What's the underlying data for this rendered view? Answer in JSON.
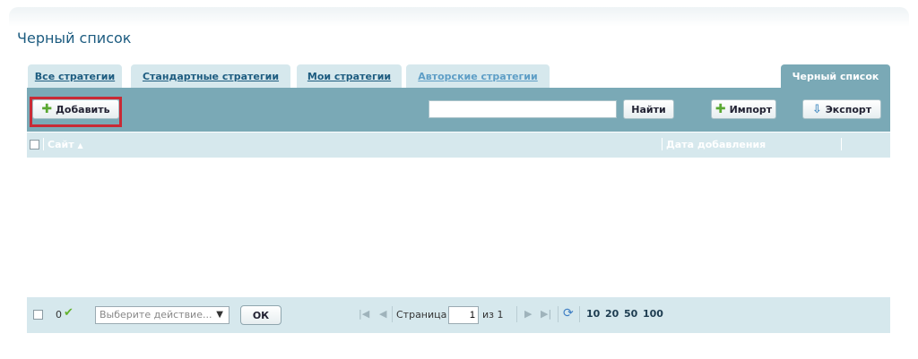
{
  "page": {
    "title": "Черный список"
  },
  "tabs": [
    {
      "label": "Все стратегии"
    },
    {
      "label": "Стандартные стратегии"
    },
    {
      "label": "Мои стратегии"
    },
    {
      "label": "Авторские стратегии"
    },
    {
      "label": "Черный список",
      "active": true
    }
  ],
  "toolbar": {
    "add_label": "Добавить",
    "search_value": "",
    "find_label": "Найти",
    "import_label": "Импорт",
    "export_label": "Экспорт"
  },
  "grid": {
    "columns": [
      {
        "label": "Сайт",
        "sort": "asc"
      },
      {
        "label": "Дата добавления"
      }
    ],
    "rows": []
  },
  "footer": {
    "selected_count": "0",
    "action_placeholder": "Выберите действие...",
    "ok_label": "ОК",
    "page_label": "Страница",
    "page_value": "1",
    "of_label": "из 1",
    "page_sizes": [
      "10",
      "20",
      "50",
      "100"
    ]
  },
  "colors": {
    "title": "#1d5c80",
    "toolbar_bg": "#7aa9b6",
    "light_row_bg": "#d6e8ed",
    "highlight": "#c82a35",
    "plus_green": "#5aa832"
  },
  "icons": {
    "add": "plus-icon",
    "import": "plus-icon",
    "export": "download-icon",
    "sort": "sort-asc-icon",
    "check": "checkmark-icon",
    "refresh": "refresh-icon"
  }
}
